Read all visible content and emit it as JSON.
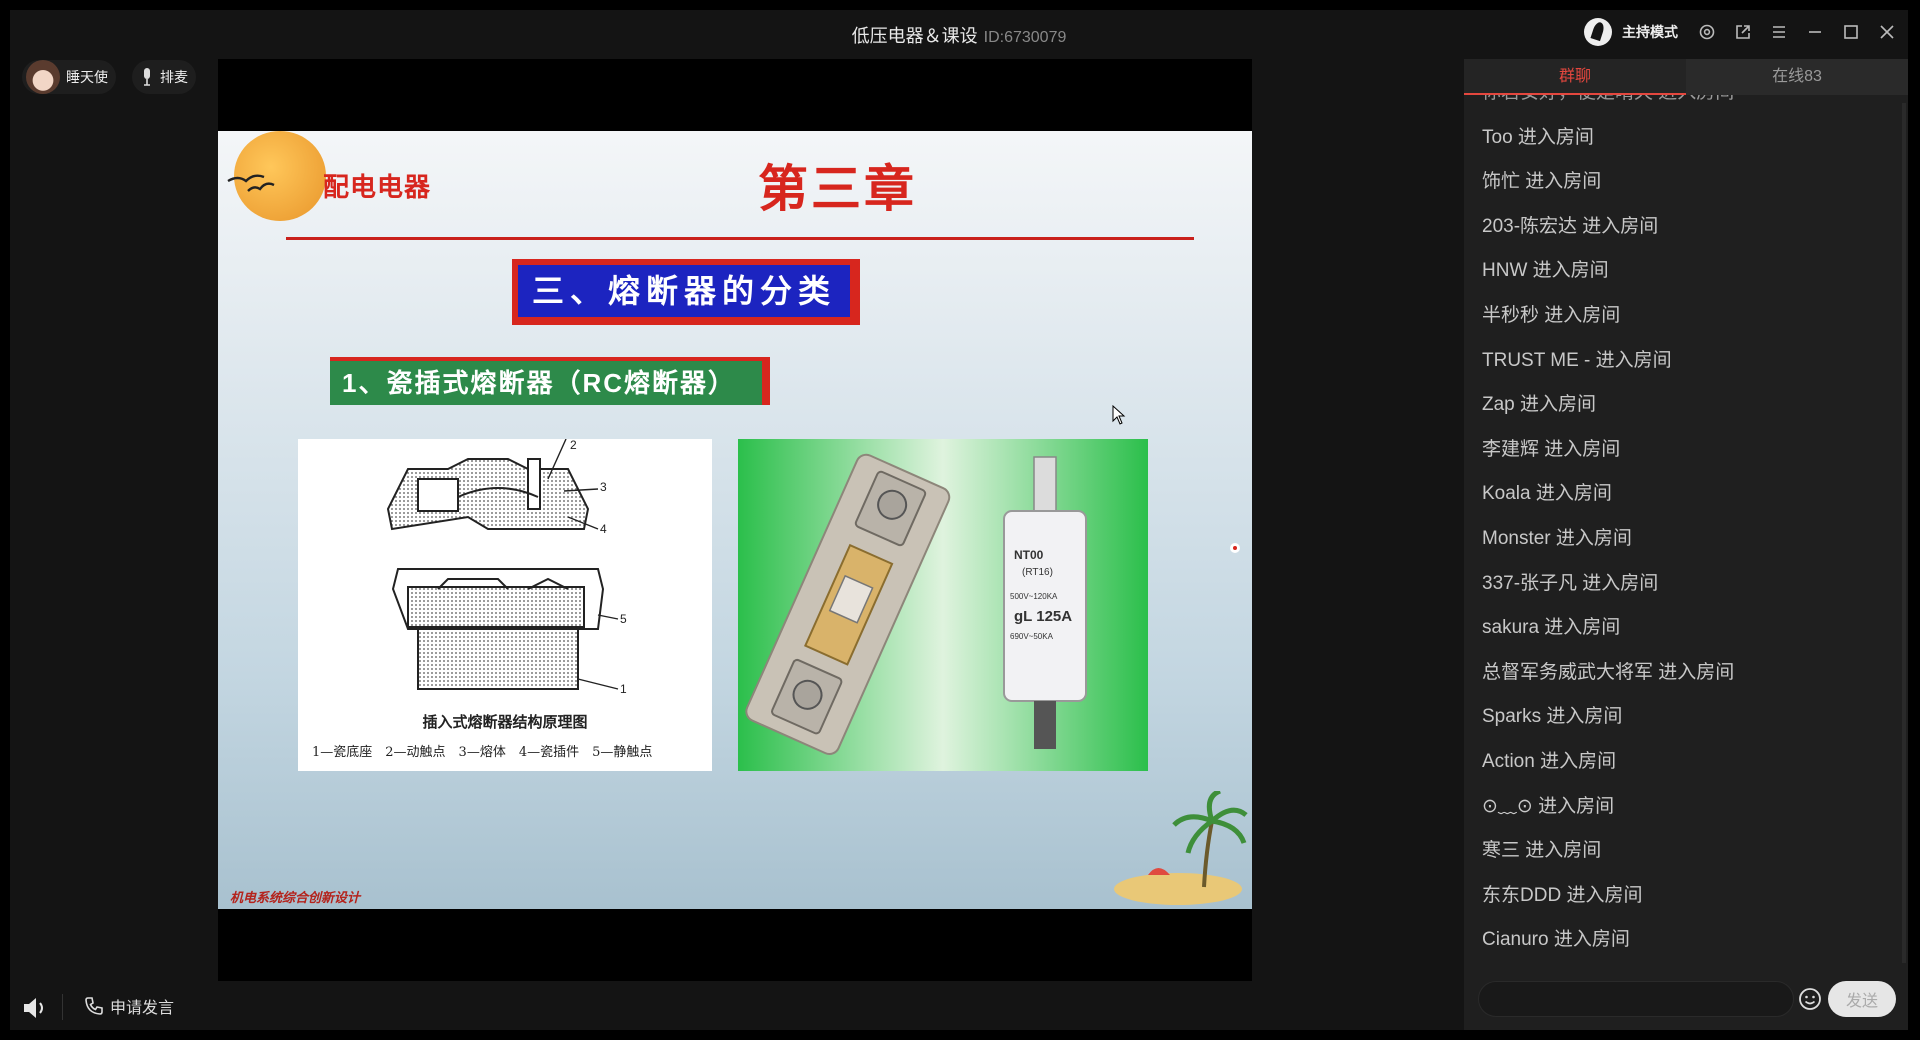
{
  "window": {
    "title": "低压电器＆课设",
    "room_id": "ID:6730079",
    "host_mode_label": "主持模式"
  },
  "users": {
    "presenter_name": "睡天使",
    "queue_label": "排麦"
  },
  "slide": {
    "brand": "配电电器",
    "chapter": "第三章",
    "section": "三、熔断器的分类",
    "subsection": "1、瓷插式熔断器（RC熔断器）",
    "diagram_caption": "插入式熔断器结构原理图",
    "diagram_legend": "1—瓷底座　2—动触点　3—熔体　4—瓷插件　5—静触点",
    "fuse_label_lines": [
      "NT00",
      "(RT16)",
      "500V~120KA",
      "gL 125A",
      "690V~50KA"
    ],
    "footer_note": "机电系统综合创新设计"
  },
  "bottom": {
    "apply_speak_label": "申请发言"
  },
  "chat": {
    "tab_group": "群聊",
    "tab_online": "在线83",
    "cut_message": "你若安好，便是晴天 进入房间",
    "messages": [
      "Too 进入房间",
      "饰忙 进入房间",
      "203-陈宏达 进入房间",
      "HNW 进入房间",
      "半秒秒 进入房间",
      "TRUST ME - 进入房间",
      "Zap 进入房间",
      "李建辉 进入房间",
      "Koala 进入房间",
      "Monster 进入房间",
      "337-张子凡 进入房间",
      "sakura 进入房间",
      "总督军务威武大将军 进入房间",
      "Sparks 进入房间",
      "Action 进入房间",
      "⊙﹏⊙ 进入房间",
      "寒三 进入房间",
      "东东DDD 进入房间",
      "Cianuro 进入房间"
    ],
    "input_placeholder": "",
    "send_label": "发送"
  },
  "colors": {
    "accent": "#e4473e",
    "slide_red": "#d7261e",
    "slide_blue": "#1c24c0",
    "slide_green": "#2d8a4a"
  }
}
